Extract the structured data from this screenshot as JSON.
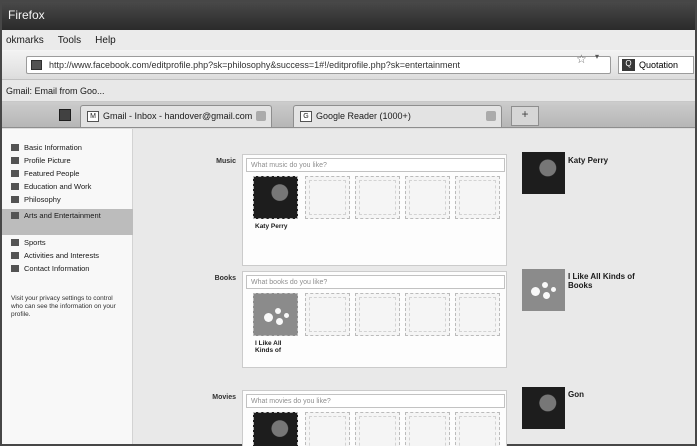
{
  "window": {
    "title": "Firefox"
  },
  "menubar": {
    "items": [
      "okmarks",
      "Tools",
      "Help"
    ]
  },
  "navbar": {
    "url": "http://www.facebook.com/editprofile.php?sk=philosophy&success=1#!/editprofile.php?sk=entertainment",
    "search_engine": "Quotation",
    "star_icon": "star-icon",
    "dropdown_icon": "dropdown-icon"
  },
  "bookmarks": {
    "text": "Gmail: Email from Goo..."
  },
  "tabs": [
    {
      "label": "Gmail - Inbox - handover@gmail.com",
      "favicon": "M"
    },
    {
      "label": "Google Reader (1000+)",
      "favicon": "G"
    }
  ],
  "new_tab_label": "+",
  "sidebar": {
    "items": [
      {
        "label": "Basic Information"
      },
      {
        "label": "Profile Picture"
      },
      {
        "label": "Featured People"
      },
      {
        "label": "Education and Work"
      },
      {
        "label": "Philosophy"
      },
      {
        "label": "Arts and Entertainment",
        "active": true
      },
      {
        "label": "Sports"
      },
      {
        "label": "Activities and Interests"
      },
      {
        "label": "Contact Information"
      }
    ],
    "note": "Visit your privacy settings to control who can see the information on your profile."
  },
  "sections": [
    {
      "label": "Music",
      "placeholder": "What music do you like?",
      "item": {
        "caption": "Katy Perry",
        "thumb": "person"
      },
      "right": {
        "name": "Katy Perry",
        "thumb": "person"
      }
    },
    {
      "label": "Books",
      "placeholder": "What books do you like?",
      "item": {
        "caption": "I Like All Kinds of",
        "thumb": "generic"
      },
      "right": {
        "name": "I Like All Kinds of Books",
        "thumb": "generic"
      }
    },
    {
      "label": "Movies",
      "placeholder": "What movies do you like?",
      "item": {
        "caption": "",
        "thumb": "person"
      },
      "right": {
        "name": "Gon",
        "thumb": "person"
      }
    }
  ]
}
